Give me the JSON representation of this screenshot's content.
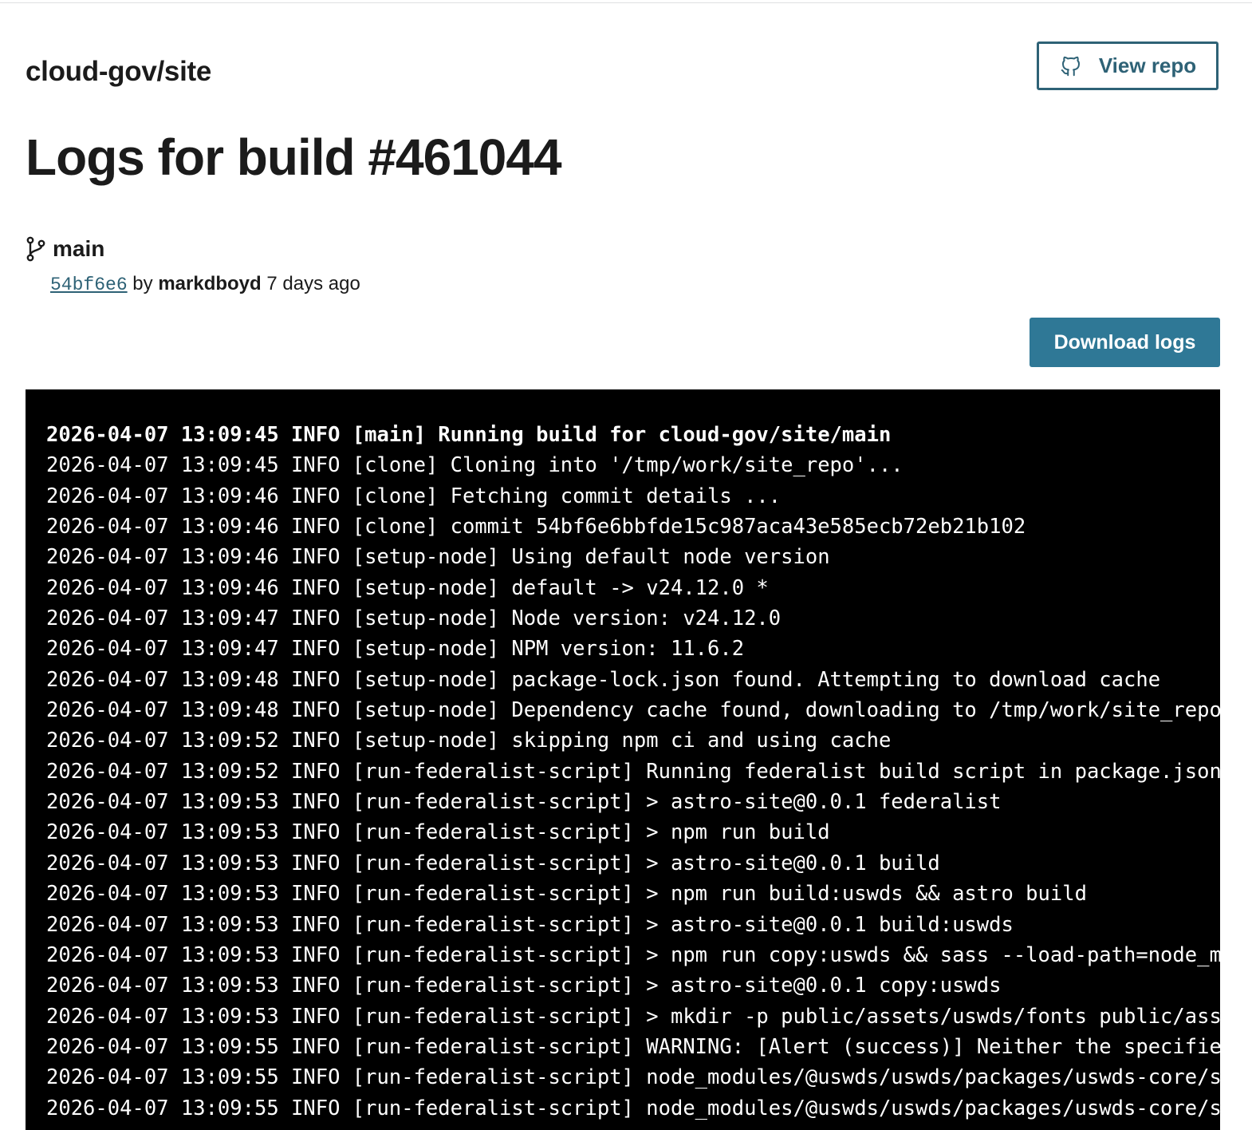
{
  "header": {
    "repo_name": "cloud-gov/site",
    "view_repo_label": "View repo",
    "title": "Logs for build #461044"
  },
  "branch": {
    "name": "main"
  },
  "commit": {
    "sha": "54bf6e6",
    "by_text": "by",
    "author": "markdboyd",
    "time_ago": "7 days ago"
  },
  "actions": {
    "download_label": "Download logs"
  },
  "logs": [
    "2026-04-07 13:09:45 INFO [main] Running build for cloud-gov/site/main",
    "2026-04-07 13:09:45 INFO [clone] Cloning into '/tmp/work/site_repo'...",
    "2026-04-07 13:09:46 INFO [clone] Fetching commit details ...",
    "2026-04-07 13:09:46 INFO [clone] commit 54bf6e6bbfde15c987aca43e585ecb72eb21b102",
    "2026-04-07 13:09:46 INFO [setup-node] Using default node version",
    "2026-04-07 13:09:46 INFO [setup-node] default -> v24.12.0 *",
    "2026-04-07 13:09:47 INFO [setup-node] Node version: v24.12.0",
    "2026-04-07 13:09:47 INFO [setup-node] NPM version: 11.6.2",
    "2026-04-07 13:09:48 INFO [setup-node] package-lock.json found. Attempting to download cache",
    "2026-04-07 13:09:48 INFO [setup-node] Dependency cache found, downloading to /tmp/work/site_repo",
    "2026-04-07 13:09:52 INFO [setup-node] skipping npm ci and using cache",
    "2026-04-07 13:09:52 INFO [run-federalist-script] Running federalist build script in package.json",
    "2026-04-07 13:09:53 INFO [run-federalist-script] > astro-site@0.0.1 federalist",
    "2026-04-07 13:09:53 INFO [run-federalist-script] > npm run build",
    "2026-04-07 13:09:53 INFO [run-federalist-script] > astro-site@0.0.1 build",
    "2026-04-07 13:09:53 INFO [run-federalist-script] > npm run build:uswds && astro build",
    "2026-04-07 13:09:53 INFO [run-federalist-script] > astro-site@0.0.1 build:uswds",
    "2026-04-07 13:09:53 INFO [run-federalist-script] > npm run copy:uswds && sass --load-path=node_m",
    "2026-04-07 13:09:53 INFO [run-federalist-script] > astro-site@0.0.1 copy:uswds",
    "2026-04-07 13:09:53 INFO [run-federalist-script] > mkdir -p public/assets/uswds/fonts public/ass",
    "2026-04-07 13:09:55 INFO [run-federalist-script] WARNING: [Alert (success)] Neither the specifie",
    "2026-04-07 13:09:55 INFO [run-federalist-script] node_modules/@uswds/uswds/packages/uswds-core/s",
    "2026-04-07 13:09:55 INFO [run-federalist-script] node_modules/@uswds/uswds/packages/uswds-core/s"
  ],
  "colors": {
    "primary": "#2f7896",
    "outline": "#2e6276",
    "log_background": "#000000",
    "log_text": "#ffffff"
  },
  "icons": {
    "view_repo": "github-icon",
    "branch": "git-branch-icon"
  }
}
